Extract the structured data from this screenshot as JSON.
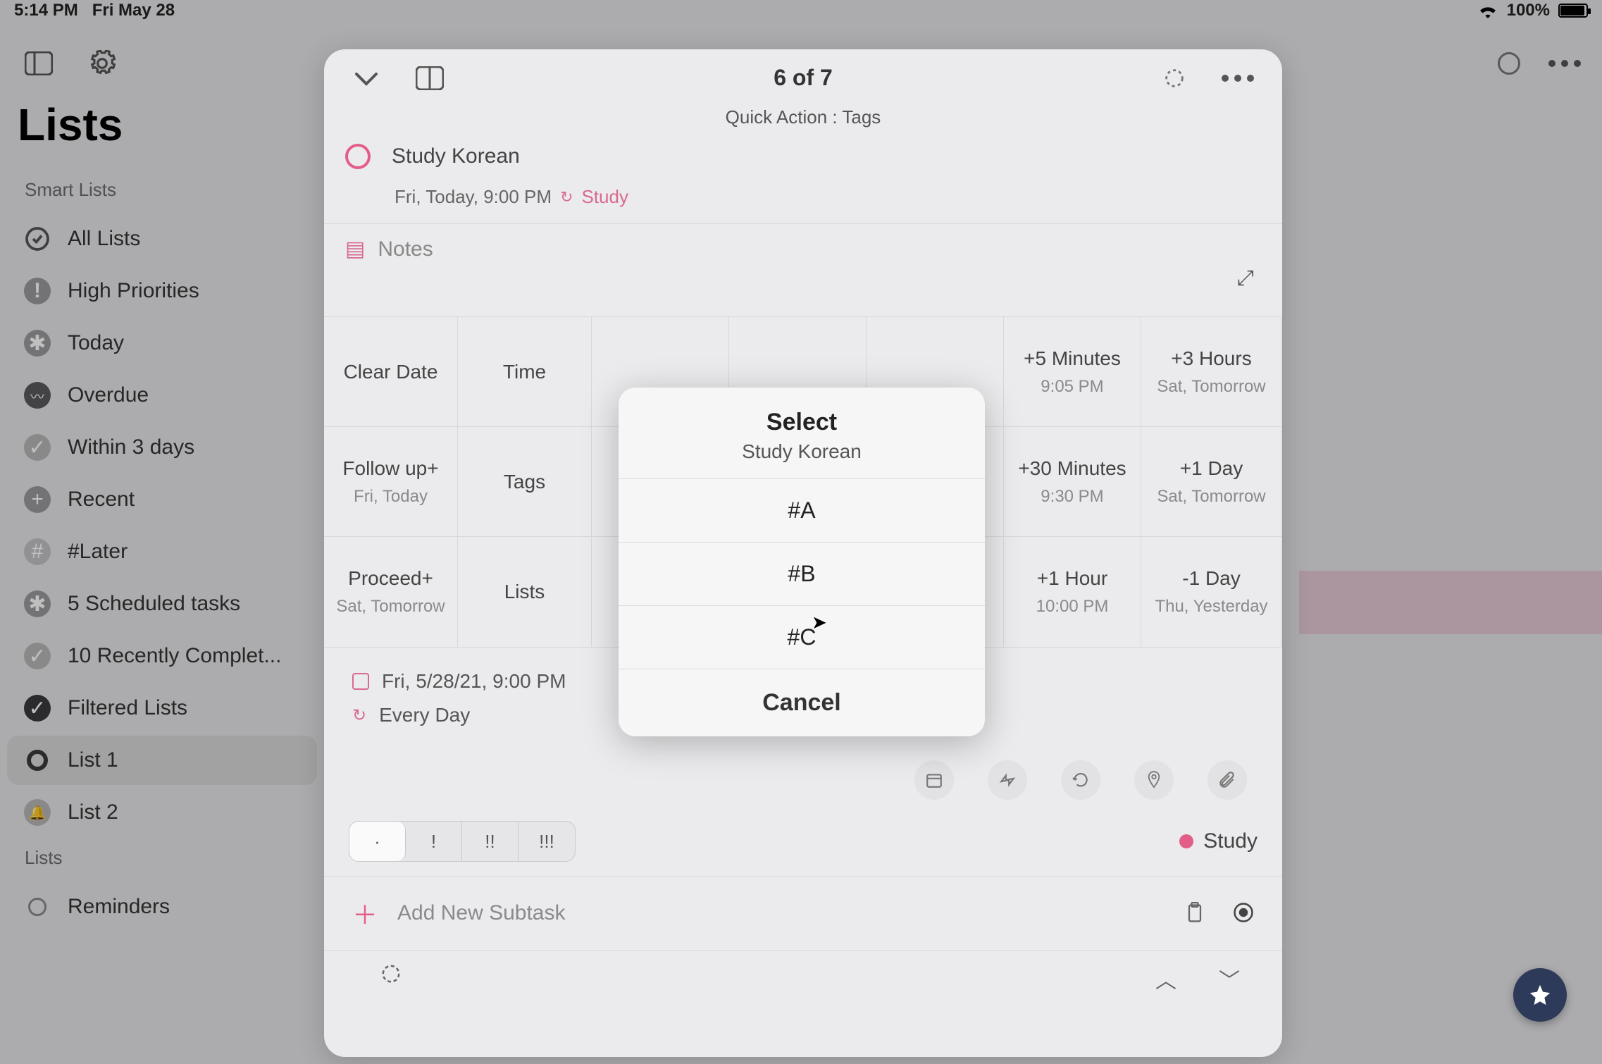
{
  "status_bar": {
    "time": "5:14 PM",
    "date": "Fri May 28",
    "battery": "100%"
  },
  "sidebar": {
    "title": "Lists",
    "section_smart": "Smart Lists",
    "section_lists": "Lists",
    "items": [
      {
        "label": "All Lists"
      },
      {
        "label": "High Priorities"
      },
      {
        "label": "Today"
      },
      {
        "label": "Overdue"
      },
      {
        "label": "Within 3 days"
      },
      {
        "label": "Recent"
      },
      {
        "label": "#Later"
      },
      {
        "label": "5 Scheduled tasks"
      },
      {
        "label": "10 Recently Complet..."
      },
      {
        "label": "Filtered Lists"
      },
      {
        "label": "List 1"
      },
      {
        "label": "List 2"
      }
    ],
    "user_lists": [
      {
        "label": "Reminders"
      }
    ]
  },
  "panel": {
    "counter": "6 of 7",
    "quick_action": "Quick Action : Tags",
    "task_title": "Study Korean",
    "meta_time": "Fri, Today, 9:00 PM",
    "meta_list": "Study",
    "notes_label": "Notes",
    "grid": {
      "r1": [
        {
          "main": "Clear Date",
          "sub": ""
        },
        {
          "main": "Time",
          "sub": ""
        },
        {
          "main": "",
          "sub": ""
        },
        {
          "main": "",
          "sub": ""
        },
        {
          "main": "",
          "sub": ""
        },
        {
          "main": "+5 Minutes",
          "sub": "9:05 PM"
        },
        {
          "main": "+3 Hours",
          "sub": "Sat, Tomorrow"
        }
      ],
      "r2": [
        {
          "main": "Follow up+",
          "sub": "Fri, Today"
        },
        {
          "main": "Tags",
          "sub": ""
        },
        {
          "main": "",
          "sub": ""
        },
        {
          "main": "",
          "sub": ""
        },
        {
          "main": "",
          "sub": ""
        },
        {
          "main": "+30 Minutes",
          "sub": "9:30 PM"
        },
        {
          "main": "+1 Day",
          "sub": "Sat, Tomorrow"
        }
      ],
      "r3": [
        {
          "main": "Proceed+",
          "sub": "Sat, Tomorrow"
        },
        {
          "main": "Lists",
          "sub": ""
        },
        {
          "main": "",
          "sub": ""
        },
        {
          "main": "",
          "sub": ""
        },
        {
          "main": "",
          "sub": ""
        },
        {
          "main": "+1 Hour",
          "sub": "10:00 PM"
        },
        {
          "main": "-1 Day",
          "sub": "Thu, Yesterday"
        }
      ]
    },
    "date_full": "Fri, 5/28/21, 9:00 PM",
    "repeat": "Every Day",
    "priority": {
      "p0": "·",
      "p1": "!",
      "p2": "!!",
      "p3": "!!!"
    },
    "study_tag": "Study",
    "add_subtask": "Add New Subtask"
  },
  "alert": {
    "title": "Select",
    "subtitle": "Study Korean",
    "options": [
      "#A",
      "#B",
      "#C"
    ],
    "cancel": "Cancel"
  }
}
